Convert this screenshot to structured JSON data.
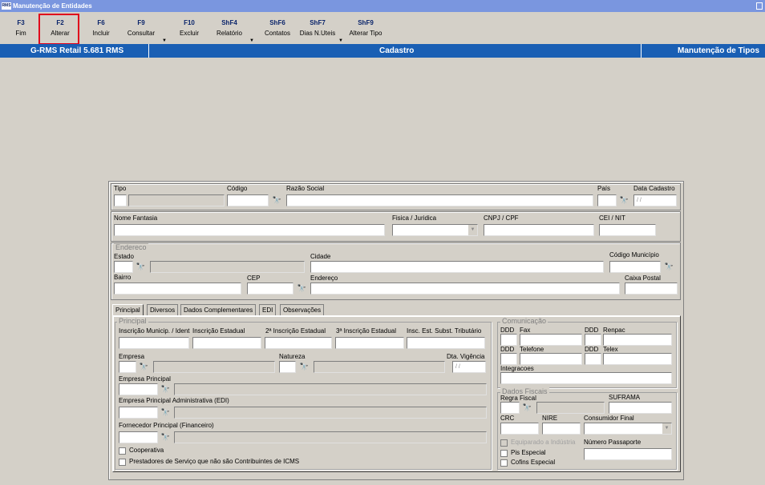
{
  "window": {
    "title": "Manutenção de Entidades",
    "logo": "RMS"
  },
  "toolbar": [
    {
      "key": "F3",
      "label": "Fim"
    },
    {
      "key": "F2",
      "label": "Alterar"
    },
    {
      "key": "F6",
      "label": "Incluir"
    },
    {
      "key": "F9",
      "label": "Consultar"
    },
    {
      "key": "F10",
      "label": "Excluir"
    },
    {
      "key": "ShF4",
      "label": "Relatório"
    },
    {
      "key": "ShF6",
      "label": "Contatos"
    },
    {
      "key": "ShF7",
      "label": "Dias N.Uteis"
    },
    {
      "key": "ShF9",
      "label": "Alterar Tipo"
    }
  ],
  "header": {
    "app": "G-RMS Retail 5.681 RMS",
    "section": "Cadastro",
    "screen": "Manutenção de Tipos"
  },
  "form": {
    "row1": {
      "tipo": "Tipo",
      "codigo": "Código",
      "razao": "Razão Social",
      "pais": "País",
      "data_cadastro": "Data Cadastro",
      "data_placeholder": "/ /"
    },
    "row2": {
      "fantasia": "Nome Fantasia",
      "fisica": "Fisica / Juridica",
      "cnpj": "CNPJ / CPF",
      "cei": "CEI / NIT"
    },
    "endereco": {
      "legend": "Endereco",
      "estado": "Estado",
      "cidade": "Cidade",
      "codigo_municipio": "Código Município",
      "bairro": "Bairro",
      "cep": "CEP",
      "endereco": "Endereço",
      "caixa_postal": "Caixa Postal"
    },
    "tabs": [
      "Principal",
      "Diversos",
      "Dados Complementares",
      "EDI",
      "Observações"
    ],
    "principal": {
      "legend": "Principal",
      "insc_municip": "Inscrição Municip. / Ident",
      "insc_estadual": "Inscrição Estadual",
      "insc2": "2ª Inscrição Estadual",
      "insc3": "3ª Inscrição Estadual",
      "insc_subst": "Insc. Est. Subst. Tributário",
      "empresa": "Empresa",
      "natureza": "Natureza",
      "dta_vigencia": "Dta. Vigência",
      "dta_placeholder": "/ /",
      "empresa_principal": "Empresa Principal",
      "empresa_adm": "Empresa Principal Administrativa (EDI)",
      "fornecedor": "Fornecedor Principal (Financeiro)",
      "cooperativa": "Cooperativa",
      "prestadores": "Prestadores de Serviço que não são Contribuintes de ICMS"
    },
    "comunicacao": {
      "legend": "Comunicação",
      "ddd": "DDD",
      "fax": "Fax",
      "renpac": "Renpac",
      "telefone": "Telefone",
      "telex": "Telex",
      "integracoes": "Integracoes"
    },
    "fiscais": {
      "legend": "Dados Fiscais",
      "regra": "Regra Fiscal",
      "suframa": "SUFRAMA",
      "crc": "CRC",
      "nire": "NIRE",
      "consumidor": "Consumidor Final",
      "equiparado": "Equiparado a Indústria",
      "passaporte": "Número Passaporte",
      "pis": "Pis Especial",
      "cofins": "Cofins Especial"
    }
  }
}
